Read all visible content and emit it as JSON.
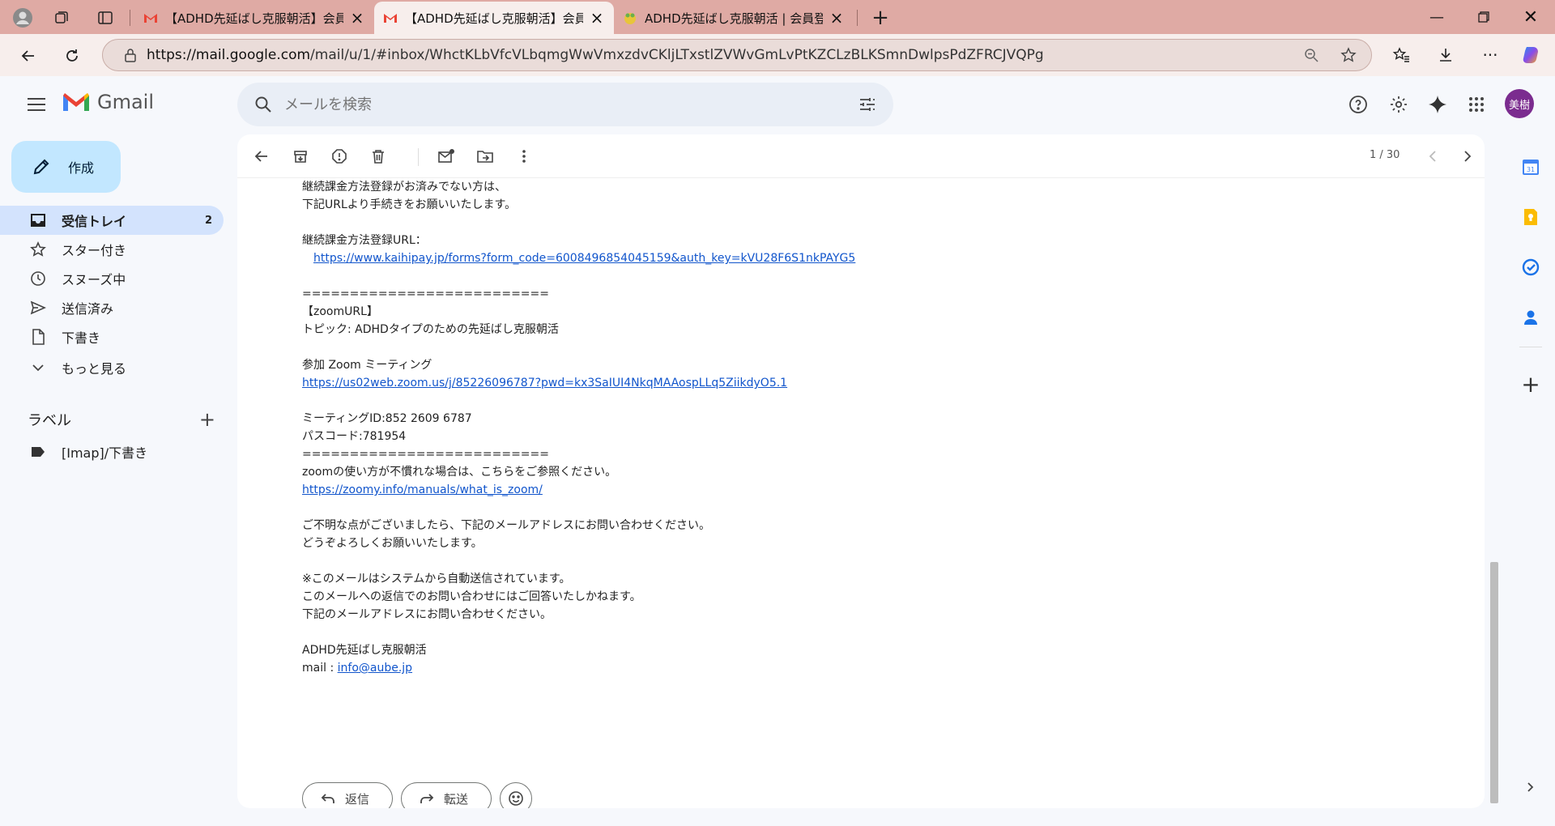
{
  "browser": {
    "tabs": [
      {
        "title": "【ADHD先延ばし克服朝活】会員登録",
        "active": false
      },
      {
        "title": "【ADHD先延ばし克服朝活】会員登録",
        "active": true
      },
      {
        "title": "ADHD先延ばし克服朝活 | 会員登録",
        "active": false
      }
    ],
    "url_host": "https://mail.google.com",
    "url_path": "/mail/u/1/#inbox/WhctKLbVfcVLbqmgWwVmxzdvCKljLTxstlZVWvGmLvPtKZCLzBLKSmnDwlpsPdZFRCJVQPg"
  },
  "gmail": {
    "brand": "Gmail",
    "search_placeholder": "メールを検索",
    "avatar_text": "美樹",
    "compose_label": "作成",
    "nav": [
      {
        "label": "受信トレイ",
        "count": "2",
        "icon": "inbox-icon",
        "active": true
      },
      {
        "label": "スター付き",
        "count": "",
        "icon": "star-icon",
        "active": false
      },
      {
        "label": "スヌーズ中",
        "count": "",
        "icon": "clock-icon",
        "active": false
      },
      {
        "label": "送信済み",
        "count": "",
        "icon": "send-icon",
        "active": false
      },
      {
        "label": "下書き",
        "count": "",
        "icon": "draft-icon",
        "active": false
      },
      {
        "label": "もっと見る",
        "count": "",
        "icon": "chevron-down-icon",
        "active": false
      }
    ],
    "labels_title": "ラベル",
    "labels": [
      "[Imap]/下書き"
    ],
    "pager": "1 / 30",
    "reply_label": "返信",
    "forward_label": "転送"
  },
  "email": {
    "lines": [
      {
        "text": "継続課金方法登録がお済みでない方は、"
      },
      {
        "text": "下記URLより手続きをお願いいたします。"
      },
      {
        "text": ""
      },
      {
        "text": "継続課金方法登録URL："
      },
      {
        "link": "https://www.kaihipay.jp/forms?form_code=6008496854045159&auth_key=kVU28F6S1nkPAYG5",
        "indent": true
      },
      {
        "text": ""
      },
      {
        "text": "=========================="
      },
      {
        "text": "【zoomURL】"
      },
      {
        "text": "トピック: ADHDタイプのための先延ばし克服朝活"
      },
      {
        "text": ""
      },
      {
        "text": "参加 Zoom ミーティング"
      },
      {
        "link": "https://us02web.zoom.us/j/85226096787?pwd=kx3SaIUI4NkqMAAospLLq5ZiikdyO5.1"
      },
      {
        "text": ""
      },
      {
        "text": "ミーティングID:852 2609 6787"
      },
      {
        "text": "パスコード:781954"
      },
      {
        "text": "=========================="
      },
      {
        "text": "zoomの使い方が不慣れな場合は、こちらをご参照ください。"
      },
      {
        "link": "https://zoomy.info/manuals/what_is_zoom/"
      },
      {
        "text": ""
      },
      {
        "text": "ご不明な点がございましたら、下記のメールアドレスにお問い合わせください。"
      },
      {
        "text": "どうぞよろしくお願いいたします。"
      },
      {
        "text": ""
      },
      {
        "text": "※このメールはシステムから自動送信されています。"
      },
      {
        "text": "このメールへの返信でのお問い合わせにはご回答いたしかねます。"
      },
      {
        "text": "下記のメールアドレスにお問い合わせください。"
      },
      {
        "text": ""
      },
      {
        "text": "ADHD先延ばし克服朝活"
      },
      {
        "text": "mail : ",
        "link": "info@aube.jp"
      }
    ]
  },
  "colors": {
    "tabbar": "#dfaaa4",
    "compose": "#c2e7ff",
    "active_nav": "#d3e3fd",
    "link": "#1155cc",
    "avatar": "#7b2c8f"
  }
}
